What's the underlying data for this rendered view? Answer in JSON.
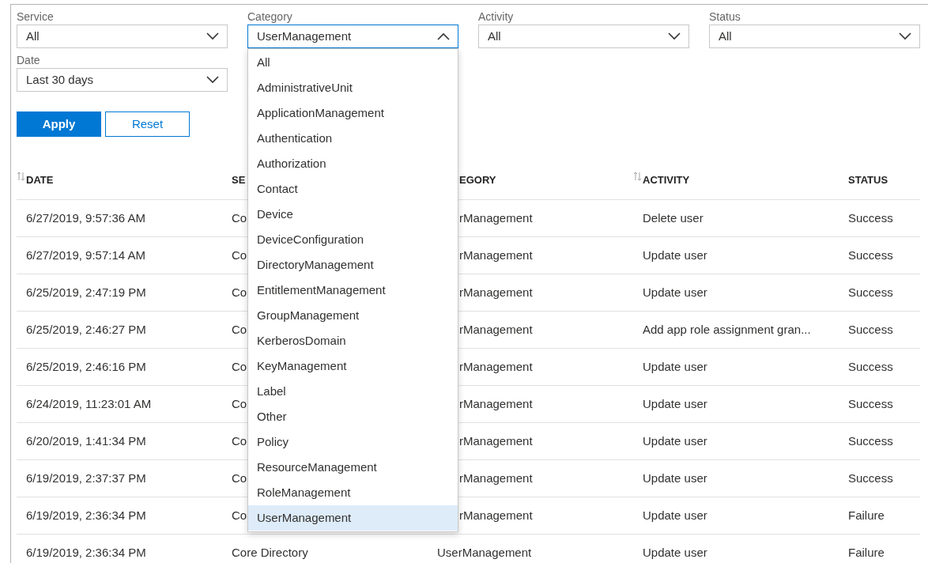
{
  "filters": [
    {
      "label": "Service",
      "value": "All",
      "expanded": false
    },
    {
      "label": "Category",
      "value": "UserManagement",
      "expanded": true,
      "options": [
        {
          "label": "All",
          "selected": false
        },
        {
          "label": "AdministrativeUnit",
          "selected": false
        },
        {
          "label": "ApplicationManagement",
          "selected": false
        },
        {
          "label": "Authentication",
          "selected": false
        },
        {
          "label": "Authorization",
          "selected": false
        },
        {
          "label": "Contact",
          "selected": false
        },
        {
          "label": "Device",
          "selected": false
        },
        {
          "label": "DeviceConfiguration",
          "selected": false
        },
        {
          "label": "DirectoryManagement",
          "selected": false
        },
        {
          "label": "EntitlementManagement",
          "selected": false
        },
        {
          "label": "GroupManagement",
          "selected": false
        },
        {
          "label": "KerberosDomain",
          "selected": false
        },
        {
          "label": "KeyManagement",
          "selected": false
        },
        {
          "label": "Label",
          "selected": false
        },
        {
          "label": "Other",
          "selected": false
        },
        {
          "label": "Policy",
          "selected": false
        },
        {
          "label": "ResourceManagement",
          "selected": false
        },
        {
          "label": "RoleManagement",
          "selected": false
        },
        {
          "label": "UserManagement",
          "selected": true
        }
      ]
    },
    {
      "label": "Activity",
      "value": "All",
      "expanded": false
    },
    {
      "label": "Status",
      "value": "All",
      "expanded": false
    },
    {
      "label": "Date",
      "value": "Last 30 days",
      "expanded": false
    }
  ],
  "buttons": [
    {
      "label": "Apply",
      "kind": "primary"
    },
    {
      "label": "Reset",
      "kind": "secondary"
    }
  ],
  "table": {
    "columns": [
      {
        "label": "DATE",
        "sortable": true
      },
      {
        "label": "SE",
        "sortable": false
      },
      {
        "label": "EGORY",
        "sortable": false
      },
      {
        "label": "ACTIVITY",
        "sortable": true
      },
      {
        "label": "STATUS",
        "sortable": false
      }
    ],
    "rows": [
      [
        "6/27/2019, 9:57:36 AM",
        "Co",
        "rManagement",
        "Delete user",
        "Success"
      ],
      [
        "6/27/2019, 9:57:14 AM",
        "Co",
        "rManagement",
        "Update user",
        "Success"
      ],
      [
        "6/25/2019, 2:47:19 PM",
        "Co",
        "rManagement",
        "Update user",
        "Success"
      ],
      [
        "6/25/2019, 2:46:27 PM",
        "Co",
        "rManagement",
        "Add app role assignment gran...",
        "Success"
      ],
      [
        "6/25/2019, 2:46:16 PM",
        "Co",
        "rManagement",
        "Update user",
        "Success"
      ],
      [
        "6/24/2019, 11:23:01 AM",
        "Co",
        "rManagement",
        "Update user",
        "Success"
      ],
      [
        "6/20/2019, 1:41:34 PM",
        "Co",
        "rManagement",
        "Update user",
        "Success"
      ],
      [
        "6/19/2019, 2:37:37 PM",
        "Co",
        "rManagement",
        "Update user",
        "Success"
      ],
      [
        "6/19/2019, 2:36:34 PM",
        "Co",
        "rManagement",
        "Update user",
        "Failure"
      ],
      [
        "6/19/2019, 2:36:34 PM",
        "Core Directory",
        "UserManagement",
        "Update user",
        "Failure"
      ]
    ]
  }
}
